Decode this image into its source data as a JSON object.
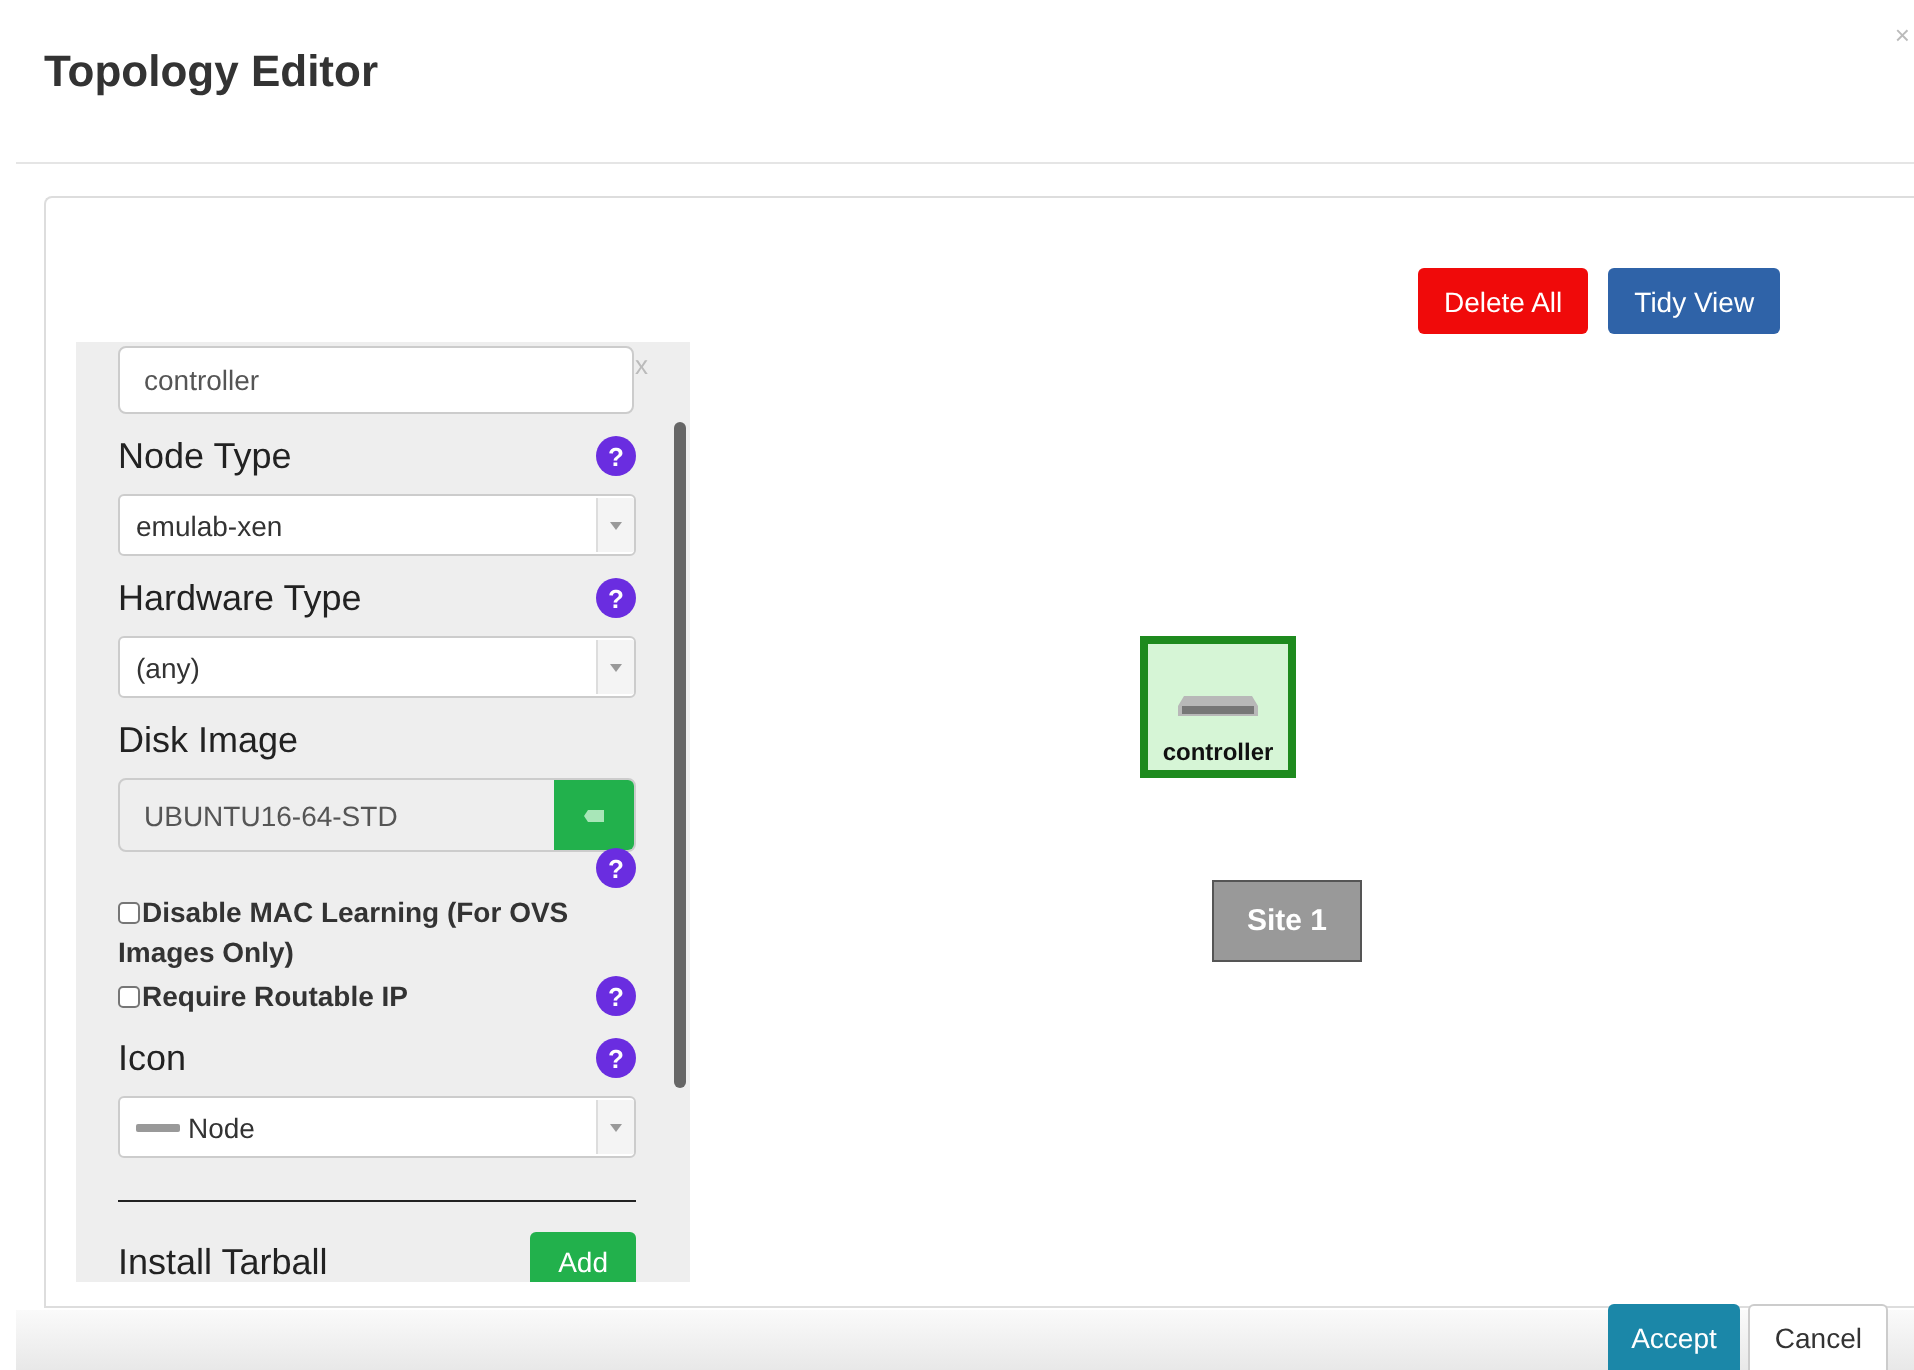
{
  "window": {
    "title": "Topology Editor",
    "close": "×"
  },
  "toolbar": {
    "buttons": [
      {
        "label": "Delete All",
        "kind": "danger"
      },
      {
        "label": "Tidy View",
        "kind": "primary"
      }
    ]
  },
  "node_editor": {
    "name": "controller",
    "clear": "x",
    "sections": [
      {
        "kind": "select",
        "label": "Node Type",
        "help": "?",
        "value": "emulab-xen"
      },
      {
        "kind": "select",
        "label": "Hardware Type",
        "help": "?",
        "value": "(any)"
      },
      {
        "kind": "image",
        "label": "Disk Image",
        "help": "?",
        "value": "UBUNTU16-64-STD"
      },
      {
        "kind": "checkbox",
        "label": "Disable MAC Learning (For OVS Images Only)",
        "checked": false
      },
      {
        "kind": "checkbox",
        "label": "Require Routable IP",
        "help": "?",
        "checked": false
      },
      {
        "kind": "icon-select",
        "label": "Icon",
        "help": "?",
        "value": "Node"
      },
      {
        "kind": "add",
        "label": "Install Tarball",
        "button": "Add"
      }
    ]
  },
  "canvas": {
    "items": [
      {
        "kind": "node",
        "label": "controller",
        "selected": true
      },
      {
        "kind": "site",
        "label": "Site 1"
      }
    ]
  },
  "footer": {
    "buttons": [
      {
        "label": "Accept",
        "kind": "primary"
      },
      {
        "label": "Cancel",
        "kind": "default"
      }
    ]
  }
}
